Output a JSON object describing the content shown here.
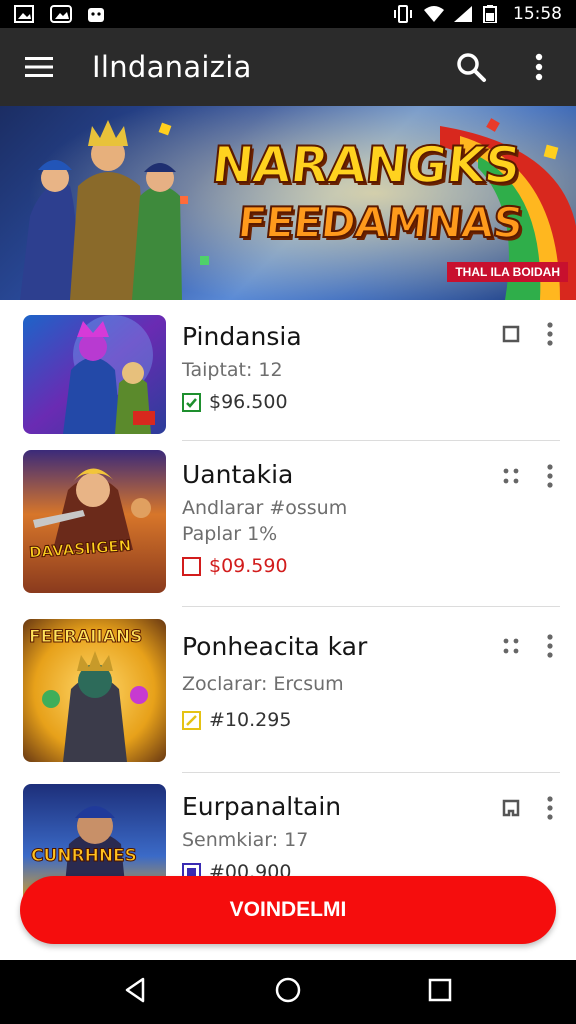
{
  "status_bar": {
    "time": "15:58",
    "icons": [
      "image-icon",
      "photo-icon",
      "android-icon",
      "vibrate-icon",
      "wifi-icon",
      "signal-icon",
      "battery-icon"
    ]
  },
  "app_bar": {
    "title": "Ilndanaizia",
    "icons": [
      "menu-icon",
      "search-icon",
      "more-vert-icon"
    ]
  },
  "banner": {
    "title_line1": "NARANGKS",
    "title_line2": "FEEDAMNAS",
    "tag": "THAL ILA BOIDAH"
  },
  "items": [
    {
      "name": "Pindansia",
      "meta": [
        "Taiptat: 12"
      ],
      "price": "$96.500",
      "price_color": "#1e8f2e",
      "action_icon": "square-outline-icon",
      "thumb_text": "",
      "thumb_colors": [
        "#2b3e9a",
        "#6a2bb3",
        "#1d64c8"
      ]
    },
    {
      "name": "Uantakia",
      "meta": [
        "Andlarar #ossum",
        "Paplar 1%"
      ],
      "price": "$09.590",
      "price_color": "#d21c1c",
      "action_icon": "drag-dots-icon",
      "thumb_text": "DAVASIIGEN",
      "thumb_colors": [
        "#8a3a1d",
        "#d7762a",
        "#3b2a7a"
      ]
    },
    {
      "name": "Ponheacita kar",
      "meta": [
        "Zoclarar: Ercsum"
      ],
      "price": "#10.295",
      "price_color": "#e5c213",
      "action_icon": "drag-dots-icon",
      "thumb_text": "FEERAIIANS",
      "thumb_colors": [
        "#e7a11a",
        "#b35a10",
        "#6b3a12"
      ]
    },
    {
      "name": "Eurpanaltain",
      "meta": [
        "Senmkiar: 17"
      ],
      "price": "#00.900",
      "price_color": "#3a2bb3",
      "action_icon": "square-bookmark-icon",
      "thumb_text": "CUNRHNES",
      "thumb_colors": [
        "#1d2f7a",
        "#3b6ac7",
        "#e0a524"
      ]
    }
  ],
  "cta": {
    "label": "VOINDELMI"
  },
  "nav_bar": {
    "icons": [
      "back-icon",
      "home-icon",
      "recents-icon"
    ]
  }
}
